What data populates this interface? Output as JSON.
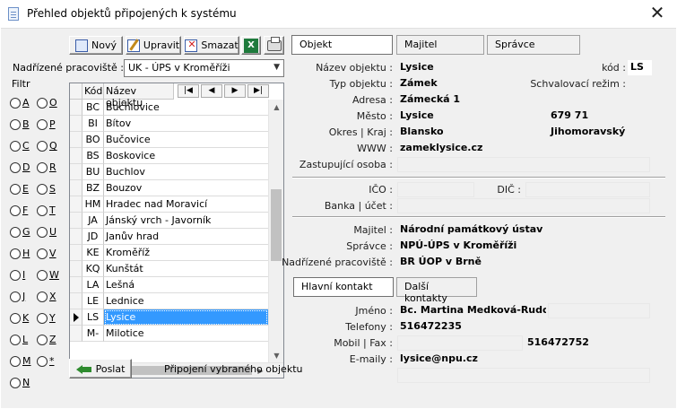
{
  "window": {
    "title": "Přehled objektů připojených k systému",
    "close": "✕"
  },
  "toolbar": {
    "new": "Nový",
    "edit": "Upravit",
    "delete": "Smazat",
    "excel": "X"
  },
  "filter": {
    "parent_label": "Nadřízené pracoviště :",
    "parent_value": "UK - ÚPS v Kroměříži",
    "filter_label": "Filtr",
    "letters_left": [
      "A",
      "B",
      "C",
      "D",
      "E",
      "F",
      "G",
      "H",
      "I",
      "J",
      "K",
      "L",
      "M",
      "N"
    ],
    "letters_right": [
      "O",
      "P",
      "Q",
      "R",
      "S",
      "T",
      "U",
      "V",
      "W",
      "X",
      "Y",
      "Z",
      "*"
    ]
  },
  "grid": {
    "col_code": "Kód",
    "col_name": "Název objektu",
    "nav": [
      "|◀",
      "◀",
      "▶",
      "▶|"
    ],
    "rows": [
      {
        "code": "BC",
        "name": "Buchlovice"
      },
      {
        "code": "BI",
        "name": "Bítov"
      },
      {
        "code": "BO",
        "name": "Bučovice"
      },
      {
        "code": "BS",
        "name": "Boskovice"
      },
      {
        "code": "BU",
        "name": "Buchlov"
      },
      {
        "code": "BZ",
        "name": "Bouzov"
      },
      {
        "code": "HM",
        "name": "Hradec nad Moravicí"
      },
      {
        "code": "JA",
        "name": "Jánský vrch - Javorník"
      },
      {
        "code": "JD",
        "name": "Janův hrad"
      },
      {
        "code": "KE",
        "name": "Kroměříž"
      },
      {
        "code": "KQ",
        "name": "Kunštát"
      },
      {
        "code": "LA",
        "name": "Lešná"
      },
      {
        "code": "LE",
        "name": "Lednice"
      },
      {
        "code": "LS",
        "name": "Lysice"
      },
      {
        "code": "M-",
        "name": "Milotice"
      }
    ],
    "selected_index": 13
  },
  "bottom": {
    "send": "Poslat",
    "hint": "Připojení vybraného objektu"
  },
  "tabs": [
    "Objekt",
    "Majitel",
    "Správce"
  ],
  "object": {
    "name_label": "Název objektu :",
    "name": "Lysice",
    "code_label": "kód :",
    "code": "LS",
    "type_label": "Typ objektu :",
    "type": "Zámek",
    "approval_label": "Schvalovací režim :",
    "address_label": "Adresa :",
    "address": "Zámecká 1",
    "city_label": "Město :",
    "city": "Lysice",
    "zip": "679 71",
    "district_label": "Okres | Kraj :",
    "district": "Blansko",
    "region": "Jihomoravský",
    "www_label": "WWW :",
    "www": "zameklysice.cz",
    "rep_label": "Zastupující osoba :",
    "ico_label": "IČO :",
    "dic_label": "DIČ :",
    "bank_label": "Banka | účet :",
    "owner_label": "Majitel :",
    "owner": "Národní památkový ústav",
    "manager_label": "Správce :",
    "manager": "NPÚ-ÚPS v Kroměříži",
    "parent_label": "Nadřízené pracoviště :",
    "parent": "BR ÚOP v Brně"
  },
  "contact_tabs": [
    "Hlavní kontakt",
    "Další kontakty"
  ],
  "contact": {
    "name_label": "Jméno :",
    "name": "Bc. Martina Medková-Rudolfová",
    "phone_label": "Telefony :",
    "phone": "516472235",
    "mobile_label": "Mobil | Fax :",
    "fax": "516472752",
    "email_label": "E-maily :",
    "email": "lysice@npu.cz"
  }
}
